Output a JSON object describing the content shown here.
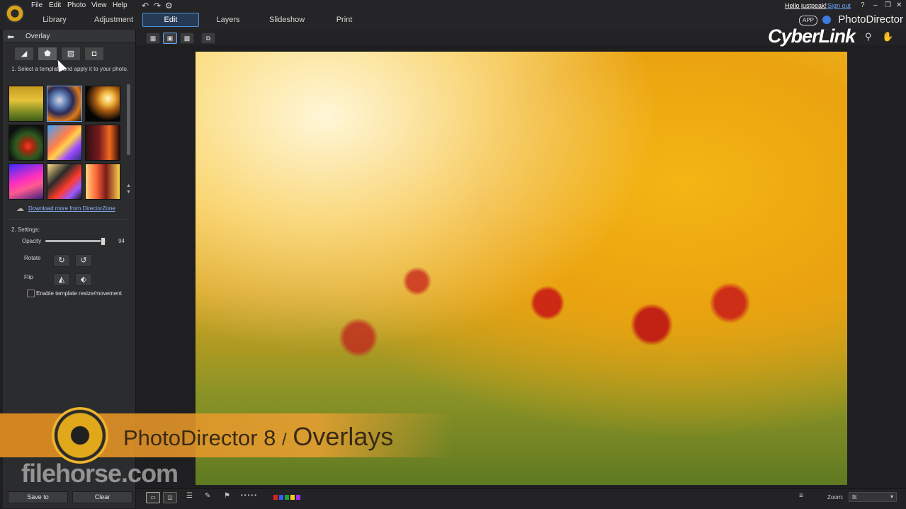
{
  "menu": [
    "File",
    "Edit",
    "Photo",
    "View",
    "Help"
  ],
  "main_tabs": {
    "library": "Library",
    "adjustment": "Adjustment",
    "edit": "Edit",
    "layers": "Layers",
    "slideshow": "Slideshow",
    "print": "Print"
  },
  "header": {
    "greeting": "Hello justpeak!",
    "signout": "Sign out",
    "app_badge": "APP",
    "product": "PhotoDirector",
    "help": "?",
    "brand": "CyberLink"
  },
  "panel": {
    "title": "Overlay",
    "step1": "1. Select a template and apply it to your photo.",
    "download_link": "Download more from DirectorZone",
    "step2": "2. Settings:",
    "opacity_label": "Opacity",
    "opacity_value": "94",
    "opacity_fraction": 0.94,
    "rotate_label": "Rotate",
    "flip_label": "Flip",
    "checkbox_label": "Enable template resize/movement"
  },
  "buttons": {
    "save_to": "Save to",
    "clear": "Clear"
  },
  "status": {
    "zoom_label": "Zoom:",
    "zoom_value": "fit"
  },
  "overlay_title": {
    "product": "PhotoDirector 8",
    "sep": "/",
    "topic": "Overlays"
  },
  "watermark": "filehorse.com",
  "icons": {
    "back": "arrow-left-icon",
    "undo": "undo-icon",
    "redo": "redo-icon",
    "settings": "gear-icon",
    "search": "magnifier-icon",
    "hand": "hand-icon"
  },
  "colors": {
    "accent": "#4f8fd6",
    "link": "#8fb3ff",
    "title_band": "#e08c1e"
  },
  "flag_colors": [
    "#e02020",
    "#3060ff",
    "#20a040",
    "#f0d020",
    "#a030ff"
  ]
}
